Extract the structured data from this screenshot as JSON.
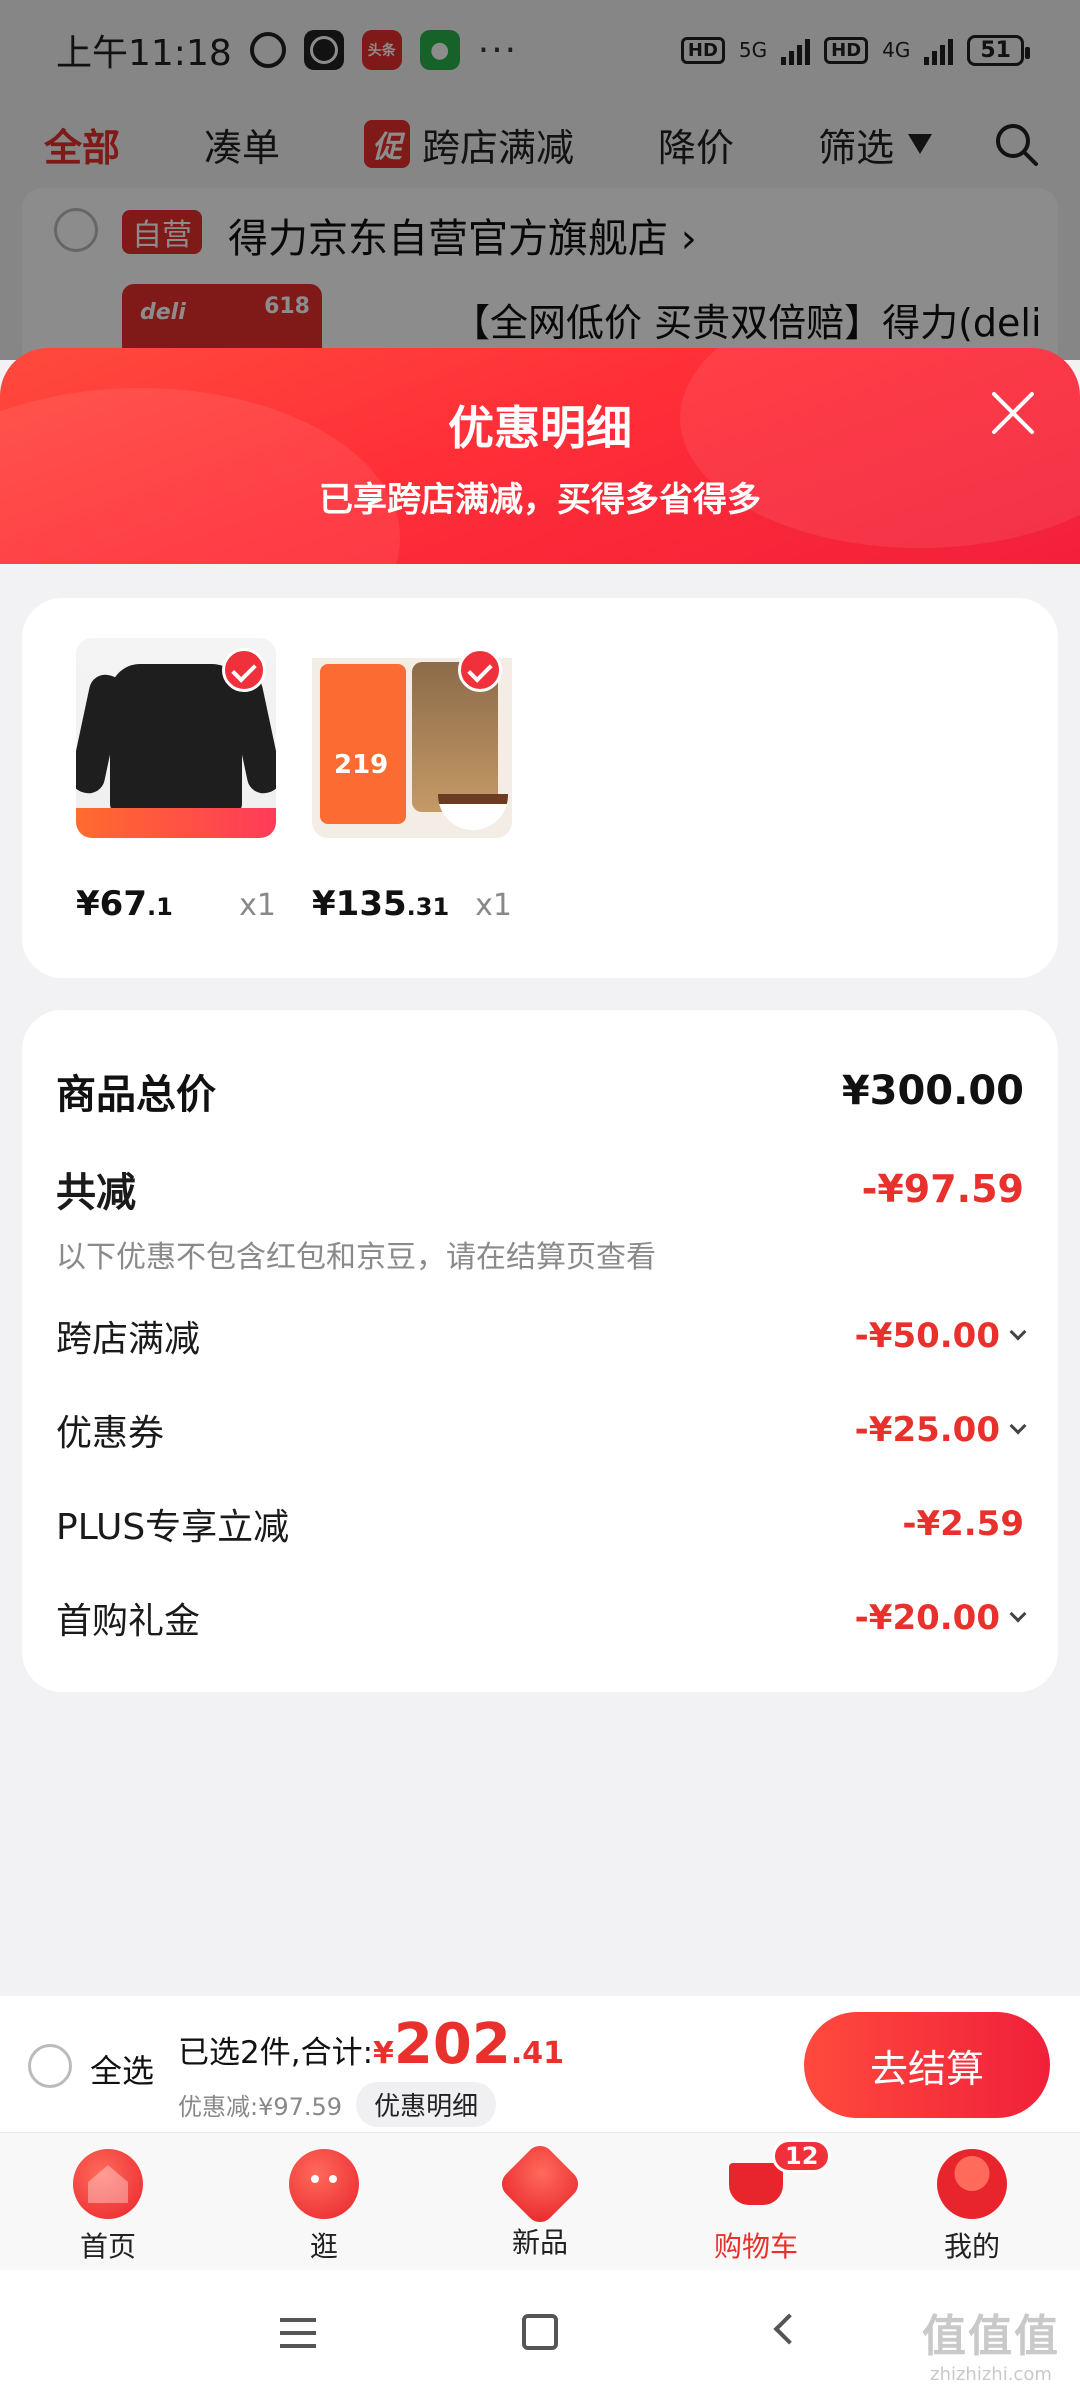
{
  "status_bar": {
    "time": "上午11:18",
    "news_app_label": "头条",
    "more": "···",
    "hd1": "HD",
    "net1": "5G",
    "hd2": "HD",
    "net2": "4G",
    "battery": "51"
  },
  "cart_tabs": {
    "all": "全部",
    "bundle": "凑单",
    "promo_badge": "促",
    "cross_store": "跨店满减",
    "price_drop": "降价",
    "filter": "筛选"
  },
  "shop": {
    "badge": "自营",
    "name": "得力京东自营官方旗舰店 ›",
    "product_title": "【全网低价 买贵双倍赔】得力(deli"
  },
  "sheet": {
    "title": "优惠明细",
    "subtitle": "已享跨店满减，买得多省得多"
  },
  "products": [
    {
      "price_int": "¥67",
      "price_dec": ".1",
      "qty": "x1",
      "icon": "long-sleeve-shirt"
    },
    {
      "price_int": "¥135",
      "price_dec": ".31",
      "qty": "x1",
      "icon": "pet-food-bag"
    }
  ],
  "summary": {
    "total_label": "商品总价",
    "total_value": "¥300.00",
    "reduce_label": "共减",
    "reduce_value": "-¥97.59",
    "note": "以下优惠不包含红包和京豆，请在结算页查看",
    "items": [
      {
        "label": "跨店满减",
        "value": "-¥50.00",
        "expandable": true
      },
      {
        "label": "优惠券",
        "value": "-¥25.00",
        "expandable": true
      },
      {
        "label": "PLUS专享立减",
        "value": "-¥2.59",
        "expandable": false
      },
      {
        "label": "首购礼金",
        "value": "-¥20.00",
        "expandable": true
      }
    ]
  },
  "checkout": {
    "select_all": "全选",
    "selected_text": "已选2件,合计:",
    "currency": "¥",
    "amount_int": "202",
    "amount_dec": ".41",
    "discount_text": "优惠减:¥97.59",
    "detail_btn": "优惠明细",
    "checkout_btn": "去结算"
  },
  "tabbar": {
    "items": [
      {
        "label": "首页",
        "icon": "home-icon"
      },
      {
        "label": "逛",
        "icon": "browse-icon"
      },
      {
        "label": "新品",
        "icon": "new-products-icon"
      },
      {
        "label": "购物车",
        "icon": "cart-icon",
        "badge": "12",
        "active": true
      },
      {
        "label": "我的",
        "icon": "profile-icon"
      }
    ]
  },
  "watermark": {
    "big": "值值值",
    "small": "zhizhizhi.com"
  },
  "colors": {
    "accent": "#e8312d",
    "header_gradient_start": "#ff4a3d",
    "header_gradient_end": "#f0203a"
  }
}
